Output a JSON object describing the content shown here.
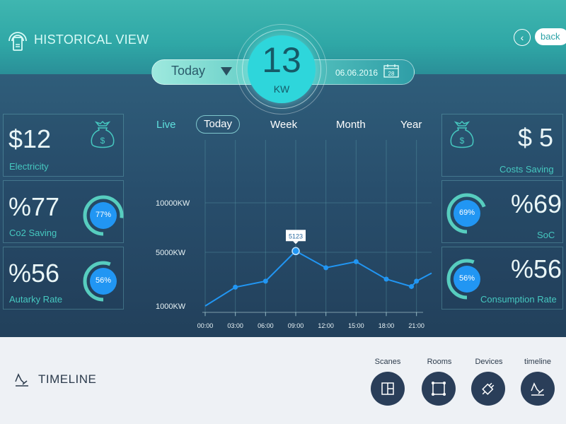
{
  "header": {
    "title": "HISTORICAL VIEW",
    "back_label": "back",
    "period_selected": "Today",
    "date": "06.06.2016",
    "calendar_day": "28",
    "power_value": "13",
    "power_unit": "KW"
  },
  "left_cards": [
    {
      "value": "$12",
      "label": "Electricity",
      "icon": "money-bag-icon"
    },
    {
      "value": "%77",
      "label": "Co2 Saving",
      "donut_text": "77%",
      "percent": 77
    },
    {
      "value": "%56",
      "label": "Autarky Rate",
      "donut_text": "56%",
      "percent": 56
    }
  ],
  "right_cards": [
    {
      "value": "$ 5",
      "label": "Costs  Saving",
      "icon": "money-bag-icon"
    },
    {
      "value": "%69",
      "label": "SoC",
      "donut_text": "69%",
      "percent": 69
    },
    {
      "value": "%56",
      "label": "Consumption Rate",
      "donut_text": "56%",
      "percent": 56
    }
  ],
  "tabs": [
    "Live",
    "Today",
    "Week",
    "Month",
    "Year"
  ],
  "chart_data": {
    "type": "line",
    "y_tick_labels": [
      "10000KW",
      "5000KW",
      "1000KW"
    ],
    "x_tick_labels": [
      "00:00",
      "03:00",
      "06:00",
      "09:00",
      "12:00",
      "15:00",
      "18:00",
      "21:00"
    ],
    "series": [
      {
        "x": [
          "00:00",
          "03:00",
          "06:00",
          "09:00",
          "12:00",
          "15:00",
          "18:00",
          "20:30",
          "21:00",
          "22:30"
        ],
        "y": [
          1000,
          2400,
          2850,
          5123,
          3850,
          4300,
          3000,
          2450,
          2850,
          3450
        ]
      }
    ],
    "highlight": {
      "x": "09:00",
      "y": 5123,
      "label": "5123"
    },
    "grid": true
  },
  "bottom": {
    "title": "TIMELINE",
    "nav": [
      {
        "label": "Scanes",
        "icon": "scenes-icon"
      },
      {
        "label": "Rooms",
        "icon": "rooms-icon"
      },
      {
        "label": "Devices",
        "icon": "devices-icon"
      },
      {
        "label": "timeline",
        "icon": "timeline-icon"
      }
    ]
  },
  "colors": {
    "teal": "#2fa7a6",
    "accent_cyan": "#2ed6db",
    "chart_line": "#2196f3",
    "donut_track": "#57cdbf",
    "nav_button": "#2a3e59"
  }
}
